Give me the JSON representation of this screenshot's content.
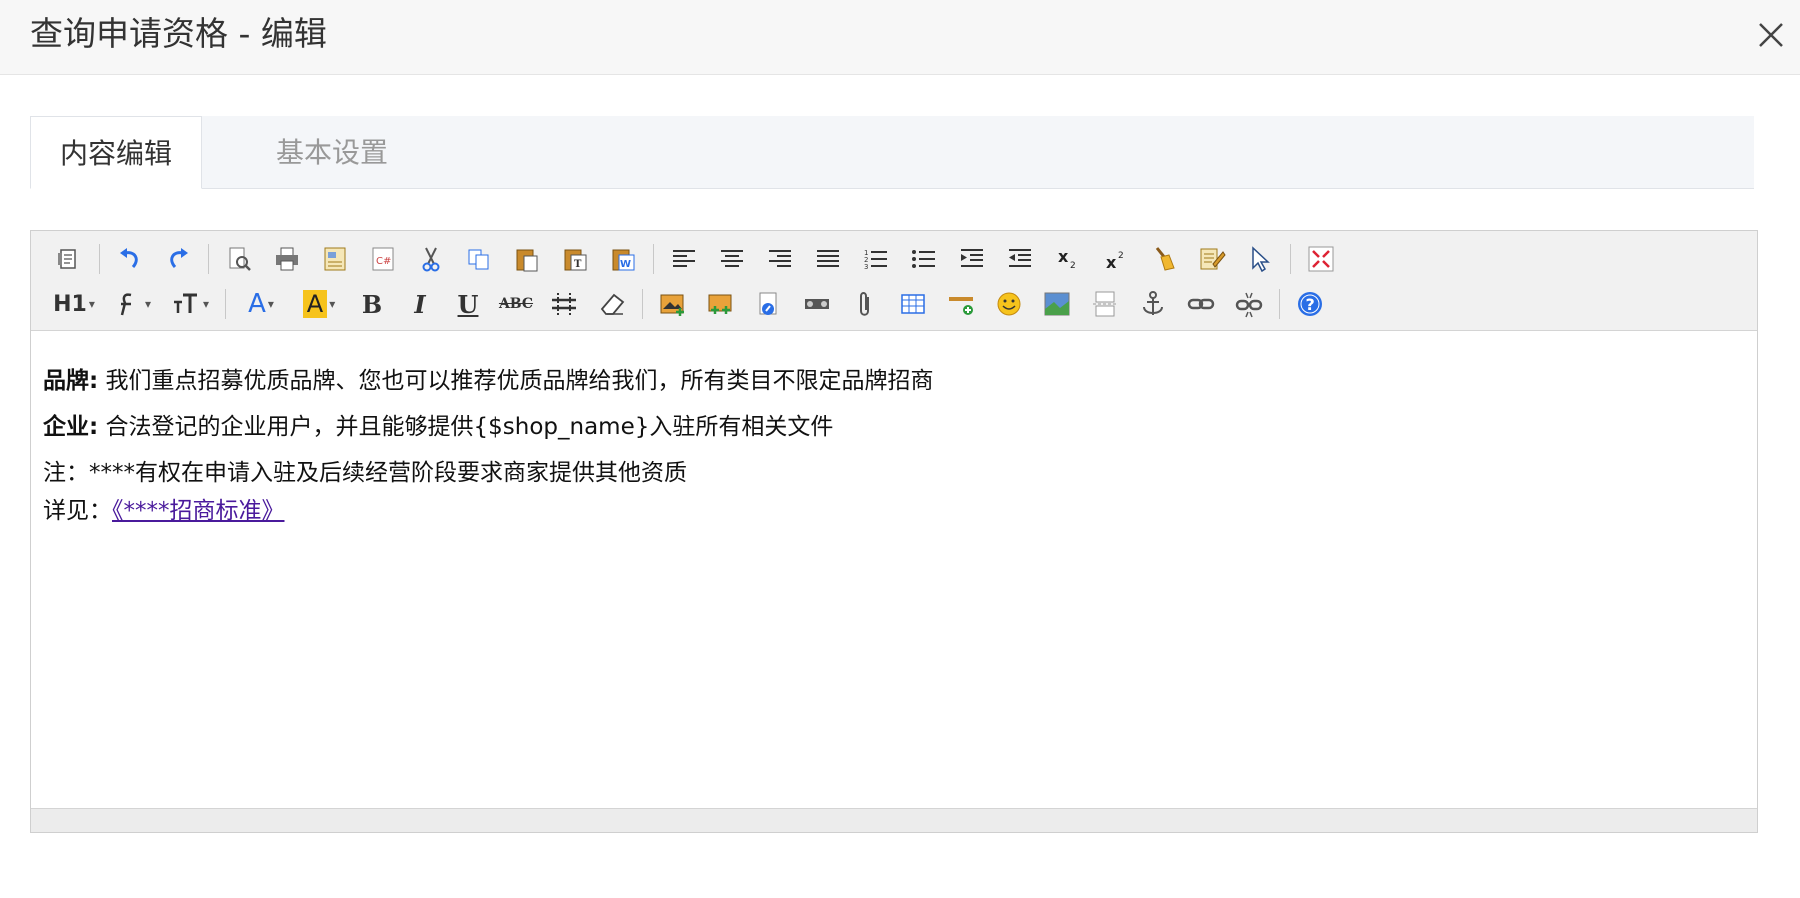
{
  "modal": {
    "title": "查询申请资格 - 编辑"
  },
  "tabs": [
    {
      "label": "内容编辑",
      "active": true
    },
    {
      "label": "基本设置",
      "active": false
    }
  ],
  "toolbar": {
    "row1": [
      "source-icon",
      "undo-icon",
      "redo-icon",
      "preview-icon",
      "print-icon",
      "template-icon",
      "code-icon",
      "cut-icon",
      "copy-icon",
      "paste-icon",
      "paste-plain-icon",
      "paste-word-icon",
      "align-left-icon",
      "align-center-icon",
      "align-right-icon",
      "justify-icon",
      "ordered-list-icon",
      "unordered-list-icon",
      "indent-icon",
      "outdent-icon",
      "subscript-icon",
      "superscript-icon",
      "clear-format-icon",
      "select-all-icon",
      "quick-format-icon",
      "fullscreen-icon"
    ],
    "row2": [
      "heading-icon",
      "font-family-icon",
      "font-size-icon",
      "font-color-icon",
      "highlight-color-icon",
      "bold-icon",
      "italic-icon",
      "underline-icon",
      "strikethrough-icon",
      "line-height-icon",
      "eraser-icon",
      "image-icon",
      "multi-image-icon",
      "flash-icon",
      "media-icon",
      "attachment-icon",
      "table-icon",
      "horizontal-line-icon",
      "emoticon-icon",
      "map-icon",
      "page-break-icon",
      "anchor-icon",
      "link-icon",
      "unlink-icon",
      "help-icon"
    ],
    "heading_label": "H1",
    "font_color_label": "A",
    "highlight_label": "A",
    "bold_label": "B",
    "italic_label": "I",
    "underline_label": "U",
    "strike_label": "ABC",
    "colors": {
      "font_color": "#2a6ee6",
      "highlight": "#f6c31c",
      "help": "#2a6ee6"
    }
  },
  "content": {
    "p1_label": "品牌:",
    "p1_text": " 我们重点招募优质品牌、您也可以推荐优质品牌给我们，所有类目不限定品牌招商",
    "p2_label": "企业:",
    "p2_text": " 合法登记的企业用户，并且能够提供{$shop_name}入驻所有相关文件",
    "p3_text": "注：****有权在申请入驻及后续经营阶段要求商家提供其他资质",
    "p4_prefix": "详见：",
    "p4_link": "《****招商标准》"
  }
}
